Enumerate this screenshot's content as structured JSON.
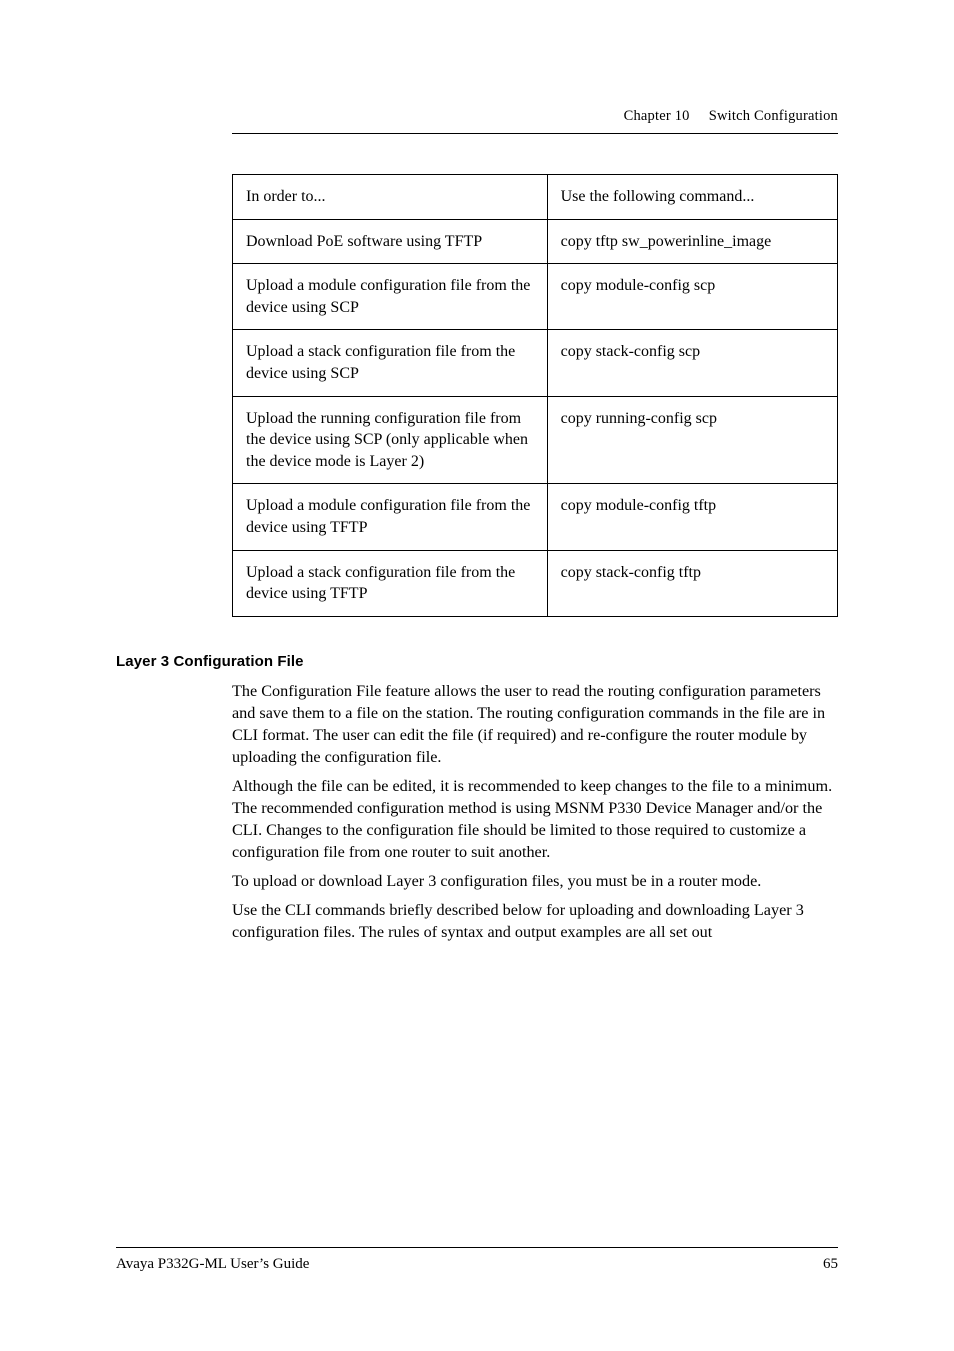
{
  "header": {
    "chapter": "Chapter 10",
    "title": "Switch Configuration"
  },
  "table": {
    "header": {
      "left": "In order to...",
      "right": "Use the following command..."
    },
    "rows": [
      {
        "left": "Download PoE software using TFTP",
        "right": "copy tftp sw_powerinline_image"
      },
      {
        "left": "Upload a module configuration file from the device using SCP",
        "right": "copy module-config scp"
      },
      {
        "left": "Upload a stack configuration file from the device using SCP",
        "right": "copy stack-config scp"
      },
      {
        "left": "Upload the running configuration file from the device using SCP (only applicable when the device mode is Layer 2)",
        "right": "copy running-config scp"
      },
      {
        "left": "Upload a module configuration file from the device using TFTP",
        "right": "copy module-config tftp"
      },
      {
        "left": "Upload a stack configuration file from the device using TFTP",
        "right": "copy stack-config tftp"
      }
    ]
  },
  "section": {
    "heading": "Layer 3 Configuration File",
    "paragraphs": [
      "The Configuration File feature allows the user to read the routing configuration parameters and save them to a file on the station. The routing configuration commands in the file are in CLI format. The user can edit the file (if required) and re-configure the router module by uploading the configuration file.",
      "Although the file can be edited, it is recommended to keep changes to the file to a minimum. The recommended configuration method is using MSNM P330 Device Manager and/or the CLI. Changes to the configuration file should be limited to those required to customize a configuration file from one router to suit another.",
      " To upload or download Layer 3 configuration files, you must be in a router mode.",
      "Use the CLI commands briefly described below for uploading and downloading Layer 3 configuration files. The rules of syntax and output examples are all set out"
    ]
  },
  "footer": {
    "left": "Avaya P332G-ML User’s Guide",
    "right": "65"
  }
}
